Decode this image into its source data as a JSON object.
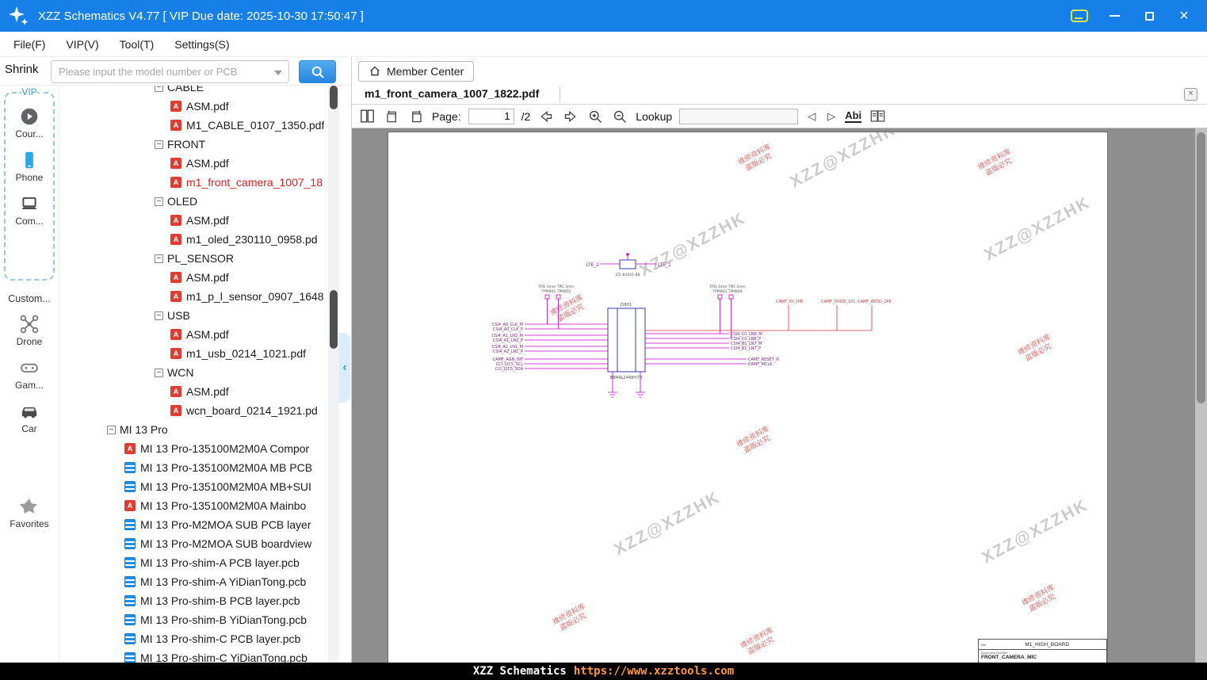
{
  "titlebar": {
    "title": "XZZ Schematics V4.77 [ VIP Due date: 2025-10-30 17:50:47 ]"
  },
  "menubar": {
    "items": [
      {
        "id": "file",
        "label": "File(F)"
      },
      {
        "id": "vip",
        "label": "VIP(V)"
      },
      {
        "id": "tool",
        "label": "Tool(T)"
      },
      {
        "id": "settings",
        "label": "Settings(S)"
      }
    ]
  },
  "querybar": {
    "shrink": "Shrink",
    "placeholder": "Please input the model number or PCB"
  },
  "member": {
    "label": "Member Center"
  },
  "sidebar": {
    "vip_title": "-VIP-",
    "vip_items": [
      {
        "id": "course",
        "icon": "play-circle",
        "label": "Cour..."
      },
      {
        "id": "phone",
        "icon": "smartphone",
        "label": "Phone"
      },
      {
        "id": "computer",
        "icon": "laptop",
        "label": "Com..."
      }
    ],
    "custom_title": "Custom...",
    "custom_items": [
      {
        "id": "drone",
        "icon": "drone",
        "label": "Drone"
      },
      {
        "id": "game",
        "icon": "gamepad",
        "label": "Gam..."
      },
      {
        "id": "car",
        "icon": "car",
        "label": "Car"
      }
    ],
    "favorites": {
      "id": "favorites",
      "icon": "star",
      "label": "Favorites"
    }
  },
  "tree": {
    "groups": [
      {
        "label": "CABLE",
        "children": [
          {
            "name": "ASM.pdf",
            "type": "pdf"
          },
          {
            "name": "M1_CABLE_0107_1350.pdf",
            "type": "pdf"
          }
        ]
      },
      {
        "label": "FRONT",
        "children": [
          {
            "name": "ASM.pdf",
            "type": "pdf"
          },
          {
            "name": "m1_front_camera_1007_18",
            "type": "pdf",
            "selected": true
          }
        ]
      },
      {
        "label": "OLED",
        "children": [
          {
            "name": "ASM.pdf",
            "type": "pdf"
          },
          {
            "name": "m1_oled_230110_0958.pd",
            "type": "pdf"
          }
        ]
      },
      {
        "label": "PL_SENSOR",
        "children": [
          {
            "name": "ASM.pdf",
            "type": "pdf"
          },
          {
            "name": "m1_p_l_sensor_0907_1648",
            "type": "pdf"
          }
        ]
      },
      {
        "label": "USB",
        "children": [
          {
            "name": "ASM.pdf",
            "type": "pdf"
          },
          {
            "name": "m1_usb_0214_1021.pdf",
            "type": "pdf"
          }
        ]
      },
      {
        "label": "WCN",
        "children": [
          {
            "name": "ASM.pdf",
            "type": "pdf"
          },
          {
            "name": "wcn_board_0214_1921.pd",
            "type": "pdf"
          }
        ]
      }
    ],
    "root": {
      "label": "MI 13 Pro",
      "children": [
        {
          "name": "MI 13 Pro-135100M2M0A Compor",
          "type": "pdf"
        },
        {
          "name": "MI 13 Pro-135100M2M0A MB PCB",
          "type": "pcb"
        },
        {
          "name": "MI 13 Pro-135100M2M0A MB+SUI",
          "type": "pcb"
        },
        {
          "name": "MI 13 Pro-135100M2M0A Mainbo",
          "type": "pdf"
        },
        {
          "name": "MI 13 Pro-M2MOA SUB PCB layer",
          "type": "pcb"
        },
        {
          "name": "MI 13 Pro-M2MOA SUB boardview",
          "type": "pcb"
        },
        {
          "name": "MI 13 Pro-shim-A PCB layer.pcb",
          "type": "pcb"
        },
        {
          "name": "MI 13 Pro-shim-A YiDianTong.pcb",
          "type": "pcb"
        },
        {
          "name": "MI 13 Pro-shim-B PCB layer.pcb",
          "type": "pcb"
        },
        {
          "name": "MI 13 Pro-shim-B YiDianTong.pcb",
          "type": "pcb"
        },
        {
          "name": "MI 13 Pro-shim-C PCB layer.pcb",
          "type": "pcb"
        },
        {
          "name": "MI 13 Pro-shim-C YiDianTong.pcb",
          "type": "pcb"
        }
      ]
    }
  },
  "tab": {
    "title": "m1_front_camera_1007_1822.pdf"
  },
  "pdfbar": {
    "page_label": "Page:",
    "page_value": "1",
    "page_total": "/2",
    "lookup_label": "Lookup",
    "abi_label": "Abi"
  },
  "viewer": {
    "watermark_gray": "XZZ@XZZHK",
    "watermark_red_line1": "维修资料库",
    "watermark_red_line2": "盗版必究"
  },
  "schematic": {
    "top": {
      "lte2": "LTE_2",
      "lte1": "LTE_1",
      "part": "LTE-B3201-B8"
    },
    "tp_left_line1": "TPD 3mm  TPD 3mm",
    "tp_left_line2": "TPM801   TPM802",
    "tp_right_line1": "TPD 3mm  TPD 3mm",
    "tp_right_line2": "TPM803   TPM804",
    "power_nets": [
      "CAMF_IO_1P8",
      "CAMF_DVDD_1P1",
      "CAMF_AVDD_2P8"
    ],
    "left_nets": [
      "CSI4_A0_CLK_M",
      "CSI4_A0_CLK_P",
      "CSI4_A1_LN2_M",
      "CSI4_A1_LN2_P",
      "CSI4_A2_LN1_M",
      "CSI4_A2_LN1_P",
      "CAMF_AGN_INT",
      "CCI_I2C5_SCL",
      "CCI_I2C5_SDA"
    ],
    "right_nets": [
      "CSI4_C0_LN8_M",
      "CSI4_C0_LN8_P",
      "CSI4_B1_LN7_M",
      "CSI4_B1_LN7_P",
      "CAMF_RESET_N",
      "CAMF_MCLK"
    ],
    "connector_ref": "J5801",
    "connector_part": "BBM4L2448H-T3"
  },
  "titleblock": {
    "title_label": "Title",
    "title_value": "M1_HIGH_BOARD",
    "doc_label": "Document Number",
    "doc_value": "FRONT_CAMERA_MIC"
  },
  "statusbar": {
    "app": "XZZ Schematics",
    "url": "https://www.xzztools.com"
  }
}
